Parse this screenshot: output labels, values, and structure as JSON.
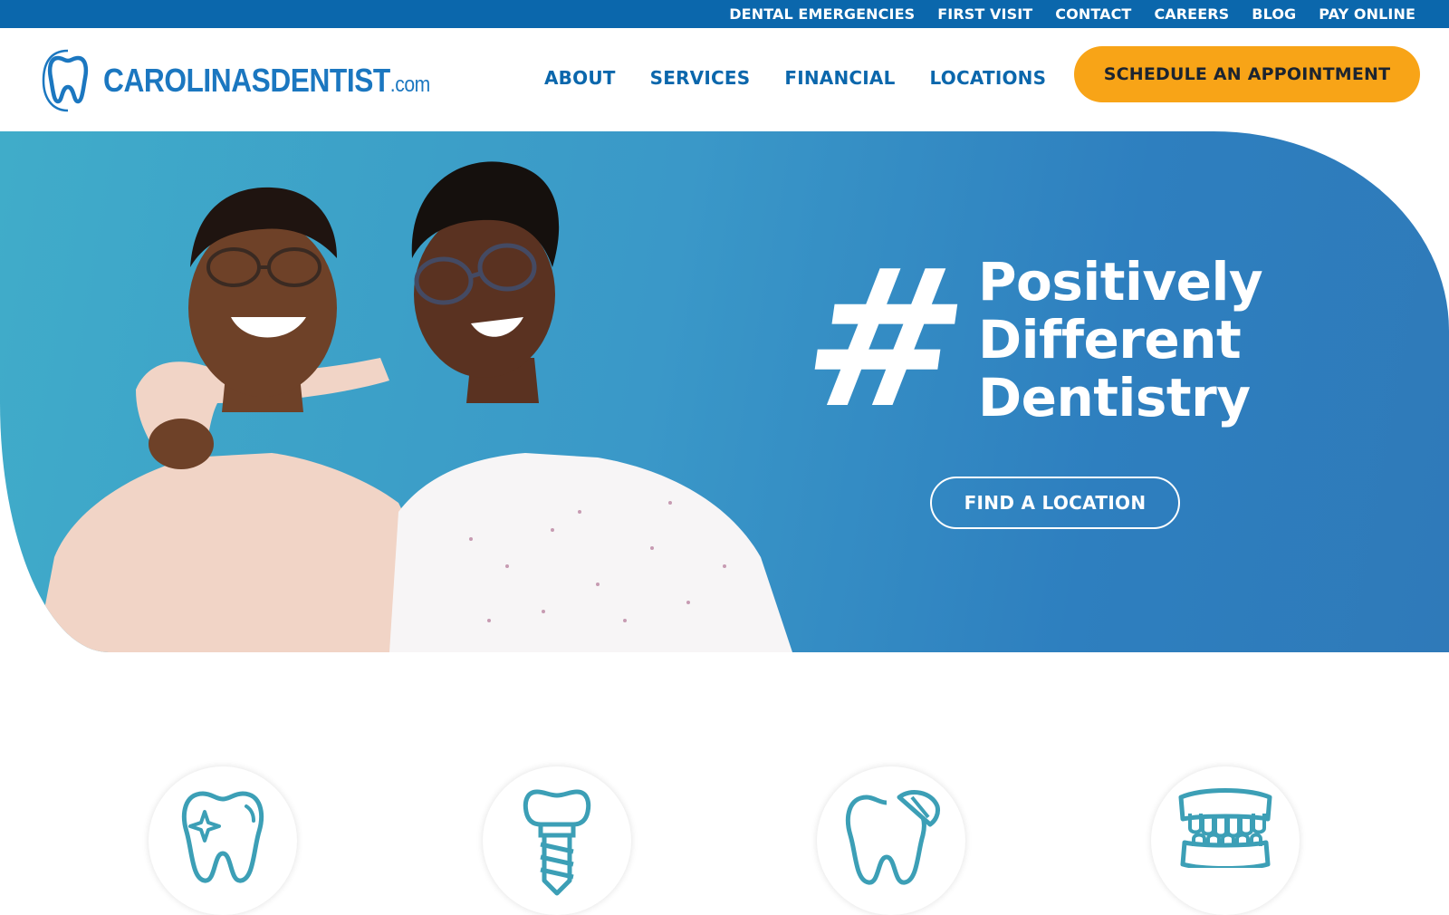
{
  "topbar": {
    "links": [
      "DENTAL EMERGENCIES",
      "FIRST VISIT",
      "CONTACT",
      "CAREERS",
      "BLOG",
      "PAY ONLINE"
    ]
  },
  "header": {
    "logo": {
      "main": "CAROLINASDENTIST",
      "suffix": ".com",
      "icon": "tooth-logo-icon"
    },
    "nav": [
      "ABOUT",
      "SERVICES",
      "FINANCIAL",
      "LOCATIONS"
    ],
    "cta_label": "SCHEDULE AN APPOINTMENT"
  },
  "hero": {
    "hash": "#",
    "lines": [
      "Positively",
      "Different",
      "Dentistry"
    ],
    "button_label": "FIND A LOCATION"
  },
  "services": {
    "icons": [
      "sparkling-tooth-icon",
      "dental-implant-icon",
      "tooth-crown-icon",
      "dentures-icon"
    ]
  },
  "colors": {
    "topbar": "#0b67ac",
    "nav_text": "#0b67ac",
    "cta_bg": "#f8a417",
    "hero_start": "#40acc9",
    "hero_end": "#2f7ab9",
    "icon_stroke": "#3c9fb6"
  }
}
